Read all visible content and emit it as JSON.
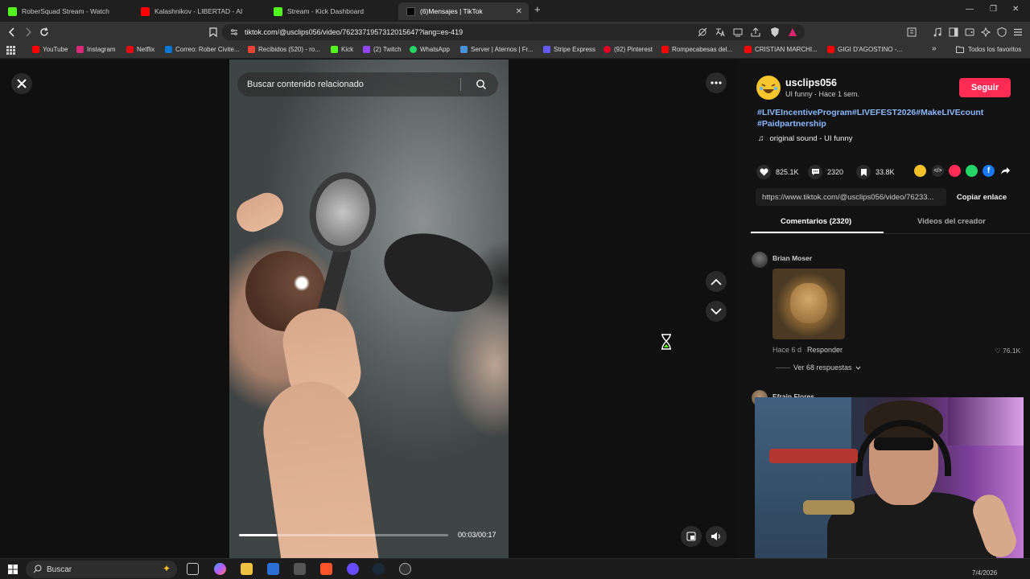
{
  "browser": {
    "tabs": [
      {
        "title": "RoberSquad Stream - Watch Live",
        "favicon_color": "#53fc18",
        "active": false
      },
      {
        "title": "Kalashnikov - LIBERTAD - AIRBAG - Y",
        "favicon_color": "#ff0000",
        "active": false
      },
      {
        "title": "Stream - Kick Dashboard",
        "favicon_color": "#53fc18",
        "active": false
      },
      {
        "title": "(6)Mensajes | TikTok",
        "favicon_color": "#000000",
        "active": true
      }
    ],
    "url": "tiktok.com/@usclips056/video/7623371957312015647?lang=es-419",
    "bookmarks": [
      {
        "label": "YouTube",
        "color": "#ff0000"
      },
      {
        "label": "Instagram",
        "color": "#d62976"
      },
      {
        "label": "Netflix",
        "color": "#e50914"
      },
      {
        "label": "Correo: Rober Civite...",
        "color": "#0078d4"
      },
      {
        "label": "Recibidos (520) - ro...",
        "color": "#ea4335"
      },
      {
        "label": "Kick",
        "color": "#53fc18"
      },
      {
        "label": "(2) Twitch",
        "color": "#9146ff"
      },
      {
        "label": "WhatsApp",
        "color": "#25d366"
      },
      {
        "label": "Server | Aternos | Fr...",
        "color": "#4a90d9"
      },
      {
        "label": "Stripe Express",
        "color": "#635bff"
      },
      {
        "label": "(92) Pinterest",
        "color": "#e60023"
      },
      {
        "label": "Rompecabesas del...",
        "color": "#ff0000"
      },
      {
        "label": "CRISTIAN MARCHI...",
        "color": "#ff0000"
      },
      {
        "label": "GIGI D'AGOSTINO -...",
        "color": "#ff0000"
      }
    ],
    "bookmarks_more": "»",
    "favorites_folder": "Todos los favoritos"
  },
  "video": {
    "search_placeholder": "Buscar contenido relacionado",
    "time": "00:03/00:17",
    "progress": 0.18
  },
  "post": {
    "username": "usclips056",
    "subtitle": "UI funny · Hace 1 sem.",
    "follow_label": "Seguir",
    "hashtags": "#LIVEIncentiveProgram#LIVEFEST2026#MakeLIVEcount #Paidpartnership",
    "sound": "original sound - UI funny",
    "likes": "825.1K",
    "comments": "2320",
    "saves": "33.8K",
    "link": "https://www.tiktok.com/@usclips056/video/76233...",
    "copy_label": "Copiar enlace",
    "tab_comments": "Comentarios (2320)",
    "tab_creator": "Videos del creador"
  },
  "comments": [
    {
      "author": "Brian Moser",
      "time": "Hace 6 d",
      "reply_label": "Responder",
      "likes": "76.1K",
      "replies_label": "Ver 68 respuestas"
    },
    {
      "author": "Efrain Flores"
    }
  ],
  "taskbar": {
    "search_label": "Buscar",
    "date": "7/4/2026"
  }
}
